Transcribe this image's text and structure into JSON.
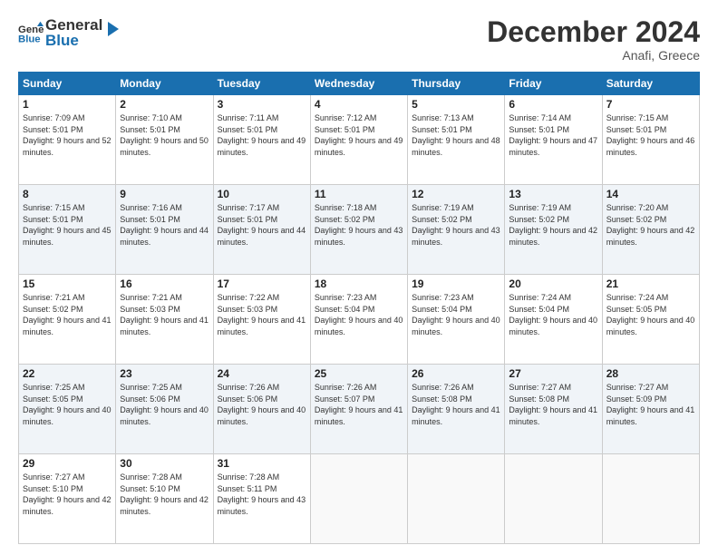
{
  "header": {
    "logo_line1": "General",
    "logo_line2": "Blue",
    "month": "December 2024",
    "location": "Anafi, Greece"
  },
  "days_of_week": [
    "Sunday",
    "Monday",
    "Tuesday",
    "Wednesday",
    "Thursday",
    "Friday",
    "Saturday"
  ],
  "weeks": [
    [
      {
        "day": "1",
        "sunrise": "7:09 AM",
        "sunset": "5:01 PM",
        "daylight": "9 hours and 52 minutes."
      },
      {
        "day": "2",
        "sunrise": "7:10 AM",
        "sunset": "5:01 PM",
        "daylight": "9 hours and 50 minutes."
      },
      {
        "day": "3",
        "sunrise": "7:11 AM",
        "sunset": "5:01 PM",
        "daylight": "9 hours and 49 minutes."
      },
      {
        "day": "4",
        "sunrise": "7:12 AM",
        "sunset": "5:01 PM",
        "daylight": "9 hours and 49 minutes."
      },
      {
        "day": "5",
        "sunrise": "7:13 AM",
        "sunset": "5:01 PM",
        "daylight": "9 hours and 48 minutes."
      },
      {
        "day": "6",
        "sunrise": "7:14 AM",
        "sunset": "5:01 PM",
        "daylight": "9 hours and 47 minutes."
      },
      {
        "day": "7",
        "sunrise": "7:15 AM",
        "sunset": "5:01 PM",
        "daylight": "9 hours and 46 minutes."
      }
    ],
    [
      {
        "day": "8",
        "sunrise": "7:15 AM",
        "sunset": "5:01 PM",
        "daylight": "9 hours and 45 minutes."
      },
      {
        "day": "9",
        "sunrise": "7:16 AM",
        "sunset": "5:01 PM",
        "daylight": "9 hours and 44 minutes."
      },
      {
        "day": "10",
        "sunrise": "7:17 AM",
        "sunset": "5:01 PM",
        "daylight": "9 hours and 44 minutes."
      },
      {
        "day": "11",
        "sunrise": "7:18 AM",
        "sunset": "5:02 PM",
        "daylight": "9 hours and 43 minutes."
      },
      {
        "day": "12",
        "sunrise": "7:19 AM",
        "sunset": "5:02 PM",
        "daylight": "9 hours and 43 minutes."
      },
      {
        "day": "13",
        "sunrise": "7:19 AM",
        "sunset": "5:02 PM",
        "daylight": "9 hours and 42 minutes."
      },
      {
        "day": "14",
        "sunrise": "7:20 AM",
        "sunset": "5:02 PM",
        "daylight": "9 hours and 42 minutes."
      }
    ],
    [
      {
        "day": "15",
        "sunrise": "7:21 AM",
        "sunset": "5:02 PM",
        "daylight": "9 hours and 41 minutes."
      },
      {
        "day": "16",
        "sunrise": "7:21 AM",
        "sunset": "5:03 PM",
        "daylight": "9 hours and 41 minutes."
      },
      {
        "day": "17",
        "sunrise": "7:22 AM",
        "sunset": "5:03 PM",
        "daylight": "9 hours and 41 minutes."
      },
      {
        "day": "18",
        "sunrise": "7:23 AM",
        "sunset": "5:04 PM",
        "daylight": "9 hours and 40 minutes."
      },
      {
        "day": "19",
        "sunrise": "7:23 AM",
        "sunset": "5:04 PM",
        "daylight": "9 hours and 40 minutes."
      },
      {
        "day": "20",
        "sunrise": "7:24 AM",
        "sunset": "5:04 PM",
        "daylight": "9 hours and 40 minutes."
      },
      {
        "day": "21",
        "sunrise": "7:24 AM",
        "sunset": "5:05 PM",
        "daylight": "9 hours and 40 minutes."
      }
    ],
    [
      {
        "day": "22",
        "sunrise": "7:25 AM",
        "sunset": "5:05 PM",
        "daylight": "9 hours and 40 minutes."
      },
      {
        "day": "23",
        "sunrise": "7:25 AM",
        "sunset": "5:06 PM",
        "daylight": "9 hours and 40 minutes."
      },
      {
        "day": "24",
        "sunrise": "7:26 AM",
        "sunset": "5:06 PM",
        "daylight": "9 hours and 40 minutes."
      },
      {
        "day": "25",
        "sunrise": "7:26 AM",
        "sunset": "5:07 PM",
        "daylight": "9 hours and 41 minutes."
      },
      {
        "day": "26",
        "sunrise": "7:26 AM",
        "sunset": "5:08 PM",
        "daylight": "9 hours and 41 minutes."
      },
      {
        "day": "27",
        "sunrise": "7:27 AM",
        "sunset": "5:08 PM",
        "daylight": "9 hours and 41 minutes."
      },
      {
        "day": "28",
        "sunrise": "7:27 AM",
        "sunset": "5:09 PM",
        "daylight": "9 hours and 41 minutes."
      }
    ],
    [
      {
        "day": "29",
        "sunrise": "7:27 AM",
        "sunset": "5:10 PM",
        "daylight": "9 hours and 42 minutes."
      },
      {
        "day": "30",
        "sunrise": "7:28 AM",
        "sunset": "5:10 PM",
        "daylight": "9 hours and 42 minutes."
      },
      {
        "day": "31",
        "sunrise": "7:28 AM",
        "sunset": "5:11 PM",
        "daylight": "9 hours and 43 minutes."
      },
      null,
      null,
      null,
      null
    ]
  ]
}
